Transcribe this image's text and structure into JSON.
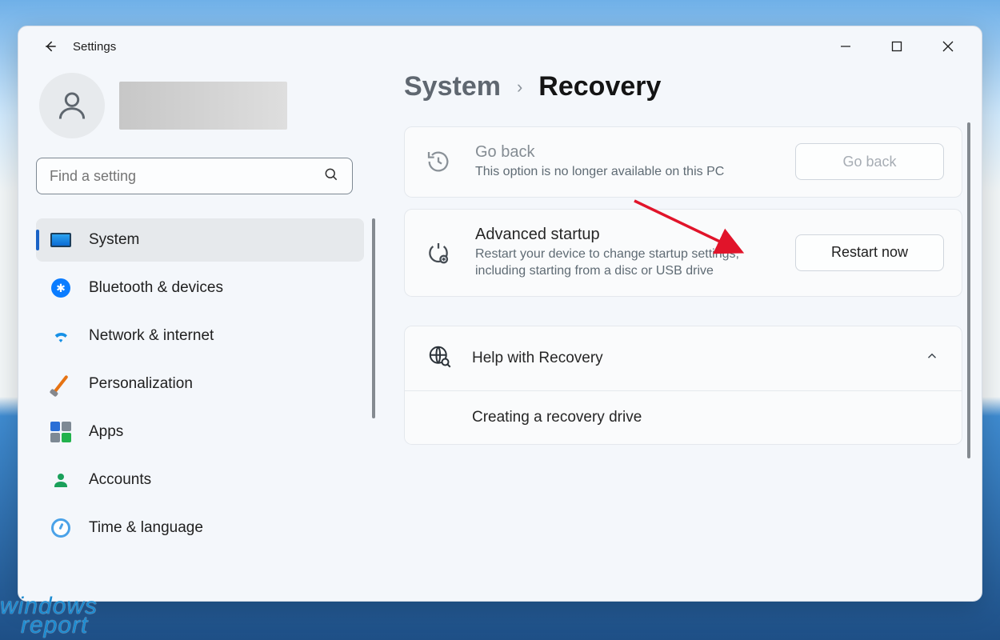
{
  "app": {
    "title": "Settings"
  },
  "search": {
    "placeholder": "Find a setting"
  },
  "sidebar": {
    "items": [
      {
        "label": "System"
      },
      {
        "label": "Bluetooth & devices"
      },
      {
        "label": "Network & internet"
      },
      {
        "label": "Personalization"
      },
      {
        "label": "Apps"
      },
      {
        "label": "Accounts"
      },
      {
        "label": "Time & language"
      }
    ],
    "active_index": 0
  },
  "breadcrumb": {
    "parent": "System",
    "current": "Recovery"
  },
  "cards": {
    "goback": {
      "title": "Go back",
      "desc": "This option is no longer available on this PC",
      "button": "Go back"
    },
    "advanced": {
      "title": "Advanced startup",
      "desc": "Restart your device to change startup settings, including starting from a disc or USB drive",
      "button": "Restart now"
    }
  },
  "help": {
    "header": "Help with Recovery",
    "items": [
      "Creating a recovery drive"
    ]
  },
  "watermark": {
    "line1": "windows",
    "line2": "report"
  }
}
